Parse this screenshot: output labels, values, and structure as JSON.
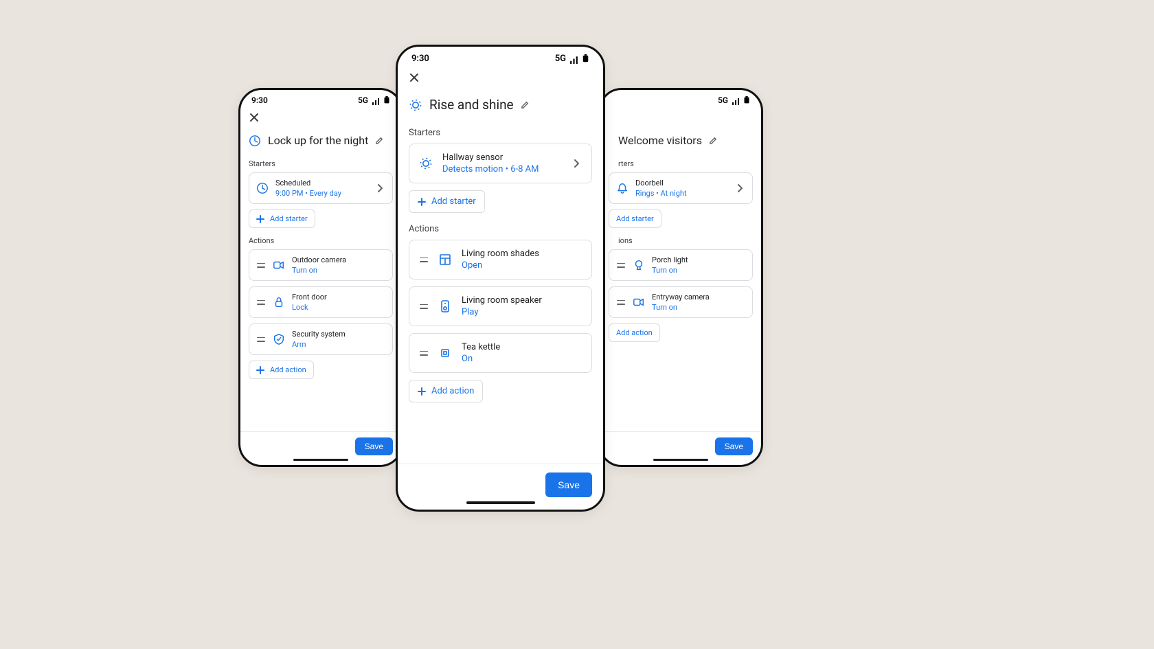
{
  "status": {
    "time": "9:30",
    "network": "5G"
  },
  "labels": {
    "starters": "Starters",
    "actions": "Actions",
    "add_starter": "Add starter",
    "add_action": "Add action",
    "save": "Save"
  },
  "left": {
    "title": "Lock up for the night",
    "starter": {
      "name": "Scheduled",
      "sub": "9:00 PM • Every day"
    },
    "actions": [
      {
        "name": "Outdoor camera",
        "sub": "Turn on"
      },
      {
        "name": "Front door",
        "sub": "Lock"
      },
      {
        "name": "Security system",
        "sub": "Arm"
      }
    ]
  },
  "center": {
    "title": "Rise and shine",
    "starter": {
      "name": "Hallway sensor",
      "sub": "Detects motion • 6-8 AM"
    },
    "actions": [
      {
        "name": "Living room shades",
        "sub": "Open"
      },
      {
        "name": "Living room speaker",
        "sub": "Play"
      },
      {
        "name": "Tea kettle",
        "sub": "On"
      }
    ]
  },
  "right": {
    "title": "Welcome visitors",
    "starter": {
      "name": "Doorbell",
      "sub": "Rings • At night"
    },
    "actions": [
      {
        "name": "Porch light",
        "sub": "Turn on"
      },
      {
        "name": "Entryway camera",
        "sub": "Turn on"
      }
    ]
  }
}
